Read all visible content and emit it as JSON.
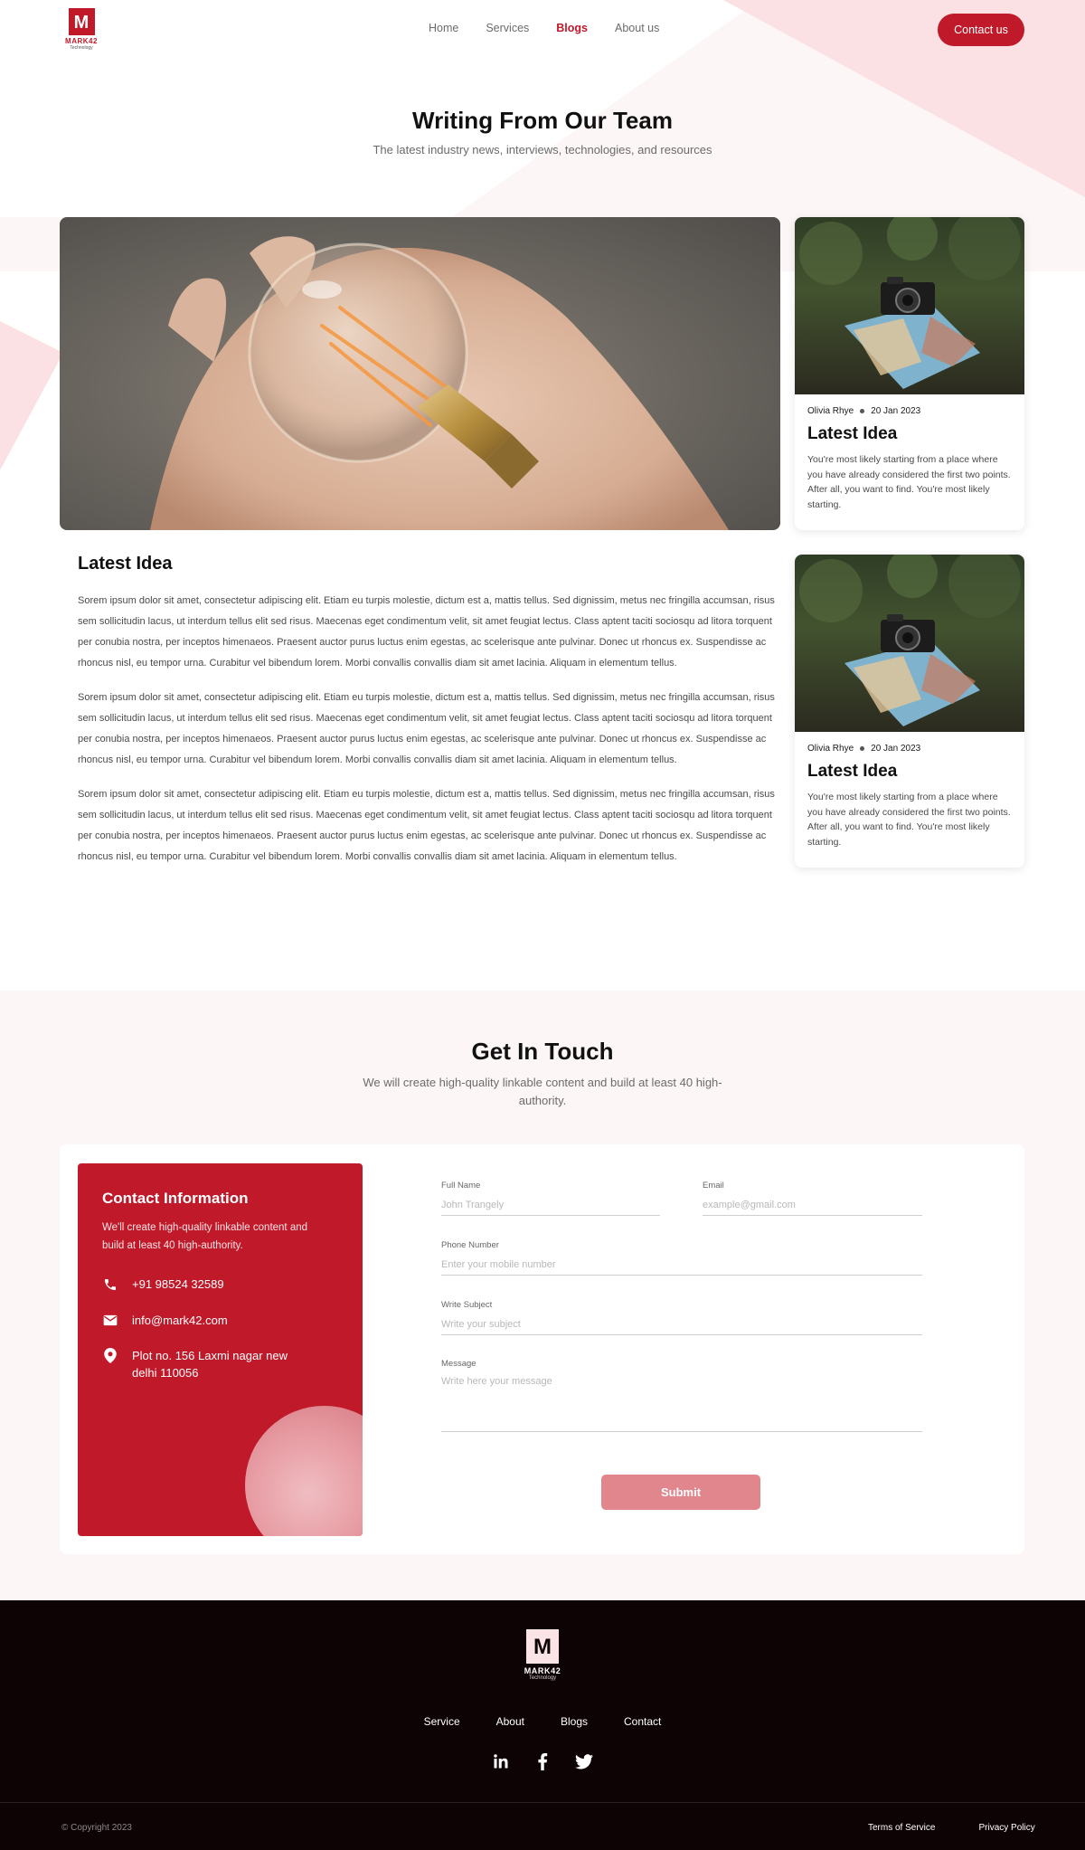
{
  "brand": {
    "logo_letter": "M",
    "name": "MARK42",
    "tagline": "Technology",
    "accent": "#c0192a"
  },
  "nav": {
    "items": [
      "Home",
      "Services",
      "Blogs",
      "About us"
    ],
    "active": "Blogs",
    "cta": "Contact us"
  },
  "hero": {
    "title": "Writing From Our Team",
    "subtitle": "The latest industry news, interviews, technologies, and resources"
  },
  "article": {
    "title": "Latest Idea",
    "paragraphs": [
      "Sorem ipsum dolor sit amet, consectetur adipiscing elit. Etiam eu turpis molestie, dictum est a, mattis tellus. Sed dignissim, metus nec fringilla accumsan, risus sem sollicitudin lacus, ut interdum tellus elit sed risus. Maecenas eget condimentum velit, sit amet feugiat lectus. Class aptent taciti sociosqu ad litora torquent per conubia nostra, per inceptos himenaeos. Praesent auctor purus luctus enim egestas, ac scelerisque ante pulvinar. Donec ut rhoncus ex. Suspendisse ac rhoncus nisl, eu tempor urna. Curabitur vel bibendum lorem. Morbi convallis convallis diam sit amet lacinia. Aliquam in elementum tellus.",
      "Sorem ipsum dolor sit amet, consectetur adipiscing elit. Etiam eu turpis molestie, dictum est a, mattis tellus. Sed dignissim, metus nec fringilla accumsan, risus sem sollicitudin lacus, ut interdum tellus elit sed risus. Maecenas eget condimentum velit, sit amet feugiat lectus. Class aptent taciti sociosqu ad litora torquent per conubia nostra, per inceptos himenaeos. Praesent auctor purus luctus enim egestas, ac scelerisque ante pulvinar. Donec ut rhoncus ex. Suspendisse ac rhoncus nisl, eu tempor urna. Curabitur vel bibendum lorem. Morbi convallis convallis diam sit amet lacinia. Aliquam in elementum tellus.",
      "Sorem ipsum dolor sit amet, consectetur adipiscing elit. Etiam eu turpis molestie, dictum est a, mattis tellus. Sed dignissim, metus nec fringilla accumsan, risus sem sollicitudin lacus, ut interdum tellus elit sed risus. Maecenas eget condimentum velit, sit amet feugiat lectus. Class aptent taciti sociosqu ad litora torquent per conubia nostra, per inceptos himenaeos. Praesent auctor purus luctus enim egestas, ac scelerisque ante pulvinar. Donec ut rhoncus ex. Suspendisse ac rhoncus nisl, eu tempor urna. Curabitur vel bibendum lorem. Morbi convallis convallis diam sit amet lacinia. Aliquam in elementum tellus."
    ]
  },
  "cards": [
    {
      "author": "Olivia Rhye",
      "date": "20 Jan 2023",
      "title": "Latest Idea",
      "desc": "You're most likely starting from a place where you have already considered the first two points. After all, you want to find. You're most likely starting."
    },
    {
      "author": "Olivia Rhye",
      "date": "20 Jan 2023",
      "title": "Latest Idea",
      "desc": "You're most likely starting from a place where you have already considered the first two points. After all, you want to find. You're most likely starting."
    }
  ],
  "touch": {
    "title": "Get In Touch",
    "subtitle": "We will create high-quality linkable content and build at least 40 high-authority."
  },
  "contact_info": {
    "title": "Contact Information",
    "desc": "We'll create high-quality linkable content and build at least 40 high-authority.",
    "phone": "+91 98524 32589",
    "email": "info@mark42.com",
    "address_line1": "Plot no. 156 Laxmi nagar new",
    "address_line2": "delhi 110056"
  },
  "form": {
    "full_name_label": "Full Name",
    "full_name_placeholder": "John Trangely",
    "email_label": "Email",
    "email_placeholder": "example@gmail.com",
    "phone_label": "Phone Number",
    "phone_placeholder": "Enter your mobile number",
    "subject_label": "Write Subject",
    "subject_placeholder": "Write your subject",
    "message_label": "Message",
    "message_placeholder": "Write here your message",
    "submit": "Submit"
  },
  "footer": {
    "nav": [
      "Service",
      "About",
      "Blogs",
      "Contact"
    ],
    "social": [
      "linkedin-icon",
      "facebook-icon",
      "twitter-icon"
    ],
    "copyright": "© Copyright 2023",
    "terms": "Terms of Service",
    "privacy": "Privacy Policy"
  }
}
